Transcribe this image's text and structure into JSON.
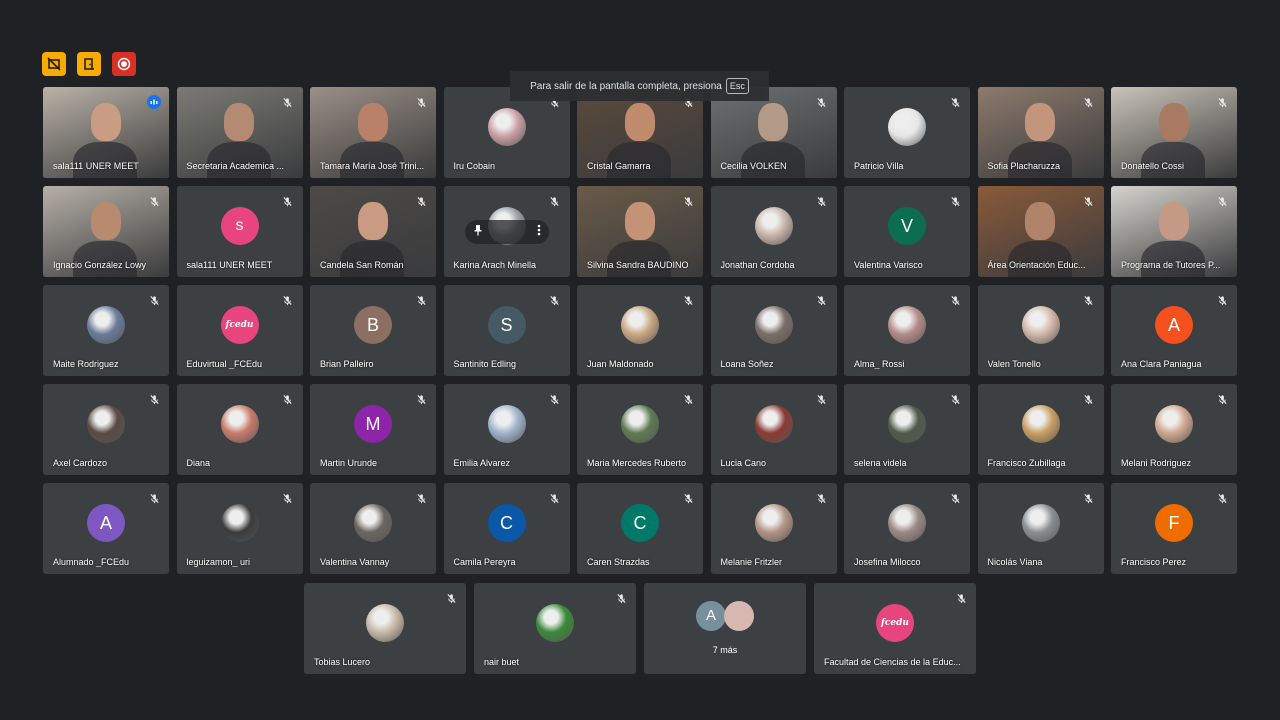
{
  "toast": {
    "text": "Para salir de la pantalla completa, presiona",
    "key": "Esc"
  },
  "top_controls": [
    {
      "name": "presentation-off-icon",
      "color": "#f9ab00"
    },
    {
      "name": "door-icon",
      "color": "#f9ab00"
    },
    {
      "name": "record-icon",
      "color": "#d93025"
    }
  ],
  "participants": [
    {
      "name": "sala111 UNER MEET",
      "kind": "video",
      "bg": "#b9b2a6",
      "face": "#c89d84",
      "speaking": true
    },
    {
      "name": "Secretaria Academica ...",
      "kind": "video",
      "bg": "#7b7a75",
      "face": "#b58a73"
    },
    {
      "name": "Tamara María José Trini...",
      "kind": "video",
      "bg": "#9a8f86",
      "face": "#b9806a"
    },
    {
      "name": "Iru Cobain",
      "kind": "photo",
      "color": "#caa0a5"
    },
    {
      "name": "Cristal Gamarra",
      "kind": "video",
      "bg": "#5b4a3c",
      "face": "#c08a6c"
    },
    {
      "name": "Cecilia VOLKEN",
      "kind": "video",
      "bg": "#6d7072",
      "face": "#b39a86"
    },
    {
      "name": "Patricio Villa",
      "kind": "photo",
      "color": "#e6e6e6"
    },
    {
      "name": "Sofia Placharuzza",
      "kind": "video",
      "bg": "#8d7a6c",
      "face": "#c2957c"
    },
    {
      "name": "Donatello Cossi",
      "kind": "video",
      "bg": "#c9c3b8",
      "face": "#a87a62"
    },
    {
      "name": "Ignacio González Lowy",
      "kind": "video",
      "bg": "#b6b0a7",
      "face": "#b88a70"
    },
    {
      "name": "sala111 UNER MEET",
      "kind": "letter",
      "letter": "s",
      "color": "#e8457f"
    },
    {
      "name": "Candela San Román",
      "kind": "video",
      "bg": "#4d4a47",
      "face": "#c99b82"
    },
    {
      "name": "Karina Arach Minella",
      "kind": "photo-overlay",
      "color": "#9aa0a6"
    },
    {
      "name": "Silvina Sandra BAUDINO",
      "kind": "video",
      "bg": "#6a5a48",
      "face": "#c49276"
    },
    {
      "name": "Jonathan Cordoba",
      "kind": "photo",
      "color": "#c8b4aa"
    },
    {
      "name": "Valentina Varisco",
      "kind": "letter",
      "letter": "V",
      "color": "#0b6e4f"
    },
    {
      "name": "Área Orientación Educ...",
      "kind": "video",
      "bg": "#8a5a3a",
      "face": "#b0846a"
    },
    {
      "name": "Programa de Tutores P...",
      "kind": "video",
      "bg": "#d6d3ce",
      "face": "#c49a84"
    },
    {
      "name": "Maite Rodriguez",
      "kind": "photo",
      "color": "#6b7c9a"
    },
    {
      "name": "Eduvirtual _FCEdu",
      "kind": "brand",
      "letter": "fcedu",
      "color": "#e8457f"
    },
    {
      "name": "Brian Palleiro",
      "kind": "letter",
      "letter": "B",
      "color": "#8d6e63"
    },
    {
      "name": "Santinito Edling",
      "kind": "letter",
      "letter": "S",
      "color": "#455a64"
    },
    {
      "name": "Juan Maldonado",
      "kind": "photo",
      "color": "#c9a882"
    },
    {
      "name": "Loana Soñez",
      "kind": "photo",
      "color": "#7a6e68"
    },
    {
      "name": "Alma_ Rossi",
      "kind": "photo",
      "color": "#b58c8a"
    },
    {
      "name": "Valen Tonello",
      "kind": "photo",
      "color": "#d2b8a8"
    },
    {
      "name": "Ana Clara Paniagua",
      "kind": "letter",
      "letter": "A",
      "color": "#f4511e"
    },
    {
      "name": "Axel Cardozo",
      "kind": "photo",
      "color": "#5a4a44"
    },
    {
      "name": "Diana",
      "kind": "photo",
      "color": "#c97b6a"
    },
    {
      "name": "Martin Urunde",
      "kind": "letter",
      "letter": "M",
      "color": "#8e24aa"
    },
    {
      "name": "Emilia Alvarez",
      "kind": "photo",
      "color": "#9fb3c8"
    },
    {
      "name": "Maria Mercedes Ruberto",
      "kind": "photo",
      "color": "#5f7a52"
    },
    {
      "name": "Lucia Cano",
      "kind": "photo",
      "color": "#8a3a32"
    },
    {
      "name": "selena videla",
      "kind": "photo",
      "color": "#4e5a4a"
    },
    {
      "name": "Francisco Zubillaga",
      "kind": "photo",
      "color": "#c9a063"
    },
    {
      "name": "Melani Rodriguez",
      "kind": "photo",
      "color": "#d0a890"
    },
    {
      "name": "Alumnado _FCEdu",
      "kind": "letter",
      "letter": "A",
      "color": "#7e57c2"
    },
    {
      "name": "leguizamon_ uri",
      "kind": "photo",
      "color": "#3b3b3b"
    },
    {
      "name": "Valentina Vannay",
      "kind": "photo",
      "color": "#6b6560"
    },
    {
      "name": "Camila Pereyra",
      "kind": "letter",
      "letter": "C",
      "color": "#0b57a8"
    },
    {
      "name": "Caren Strazdas",
      "kind": "letter",
      "letter": "C",
      "color": "#00796b"
    },
    {
      "name": "Melanie Fritzler",
      "kind": "photo",
      "color": "#b49585"
    },
    {
      "name": "Josefina Milocco",
      "kind": "photo",
      "color": "#9a8a84"
    },
    {
      "name": "Nicolás Viana",
      "kind": "photo",
      "color": "#8b8f93"
    },
    {
      "name": "Francisco Perez",
      "kind": "letter",
      "letter": "F",
      "color": "#ef6c00"
    }
  ],
  "bottom": [
    {
      "name": "Tobias Lucero",
      "kind": "photo",
      "color": "#c7b9a6"
    },
    {
      "name": "nair buet",
      "kind": "photo",
      "color": "#3a8a3a"
    },
    {
      "name": "7 más",
      "kind": "more",
      "letter": "A",
      "color": "#78909c",
      "color2": "#d6b8b0"
    },
    {
      "name": "Facultad de Ciencias de la Educ...",
      "kind": "brand",
      "letter": "fcedu",
      "color": "#e8457f"
    }
  ]
}
